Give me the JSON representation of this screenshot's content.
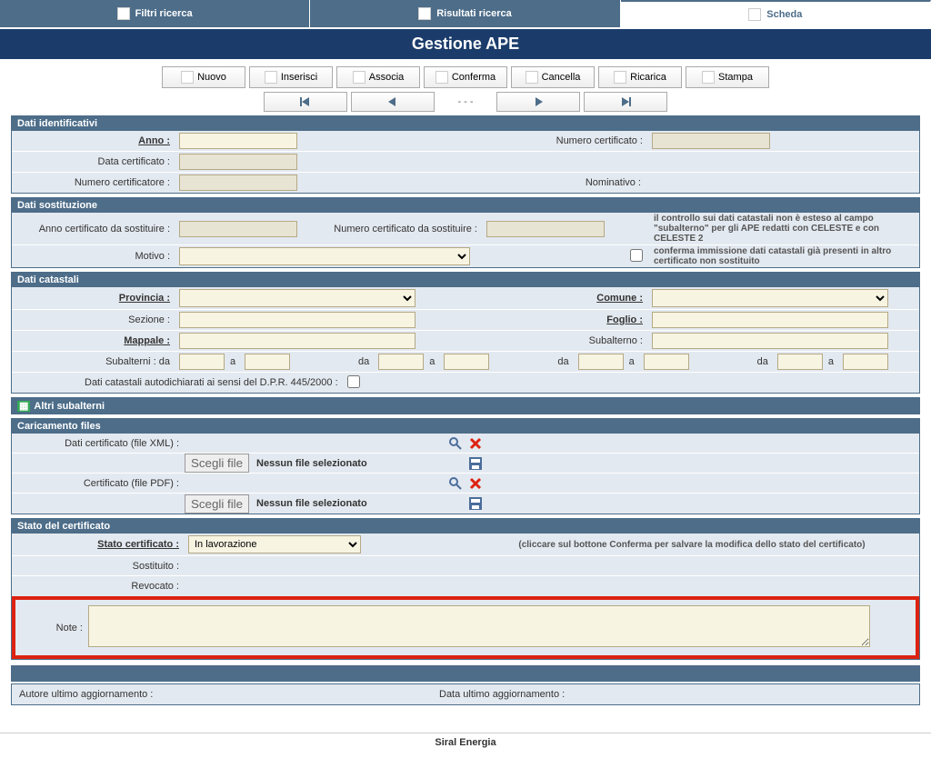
{
  "tabs": {
    "search": "Filtri ricerca",
    "results": "Risultati ricerca",
    "card": "Scheda"
  },
  "title": "Gestione APE",
  "toolbar": {
    "new": "Nuovo",
    "insert": "Inserisci",
    "assoc": "Associa",
    "confirm": "Conferma",
    "delete": "Cancella",
    "reload": "Ricarica",
    "print": "Stampa"
  },
  "nav": {
    "counter": "- - -"
  },
  "s1": {
    "hdr": "Dati identificativi",
    "anno": "Anno :",
    "anno_val": "",
    "numcert": "Numero certificato :",
    "numcert_val": "",
    "datacert": "Data certificato :",
    "datacert_val": "",
    "numcertr": "Numero certificatore :",
    "numcertr_val": "",
    "nomin": "Nominativo :",
    "nomin_val": ""
  },
  "s2": {
    "hdr": "Dati sostituzione",
    "annos": "Anno certificato da sostituire :",
    "annos_val": "",
    "nums": "Numero certificato da sostituire :",
    "nums_val": "",
    "hint1": "il controllo sui dati catastali non è esteso al campo \"subalterno\" per gli APE redatti con CELESTE e con CELESTE 2",
    "motivo": "Motivo :",
    "motivo_val": "",
    "hint2": "conferma immissione dati catastali già presenti in altro certificato non sostituito"
  },
  "s3": {
    "hdr": "Dati catastali",
    "prov": "Provincia :",
    "comune": "Comune :",
    "sez": "Sezione :",
    "foglio": "Foglio :",
    "mapp": "Mappale :",
    "sub": "Subalterno :",
    "subs": "Subalterni : da",
    "a": "a",
    "da": "da",
    "auto": "Dati catastali autodichiarati ai sensi del D.P.R. 445/2000 :"
  },
  "s4": {
    "hdr": "Altri subalterni"
  },
  "s5": {
    "hdr": "Caricamento files",
    "xml": "Dati certificato (file XML) :",
    "pdf": "Certificato (file PDF) :",
    "choose": "Scegli file",
    "nofile": "Nessun file selezionato"
  },
  "s6": {
    "hdr": "Stato del certificato",
    "stato": "Stato certificato :",
    "stato_val": "In lavorazione",
    "hint": "(cliccare sul bottone Conferma per salvare la modifica dello stato del certificato)",
    "sost": "Sostituito :",
    "revo": "Revocato :",
    "note": "Note :",
    "note_val": ""
  },
  "s7": {
    "autore": "Autore ultimo aggiornamento :",
    "data": "Data ultimo aggiornamento :"
  },
  "footer": "Siral Energia"
}
